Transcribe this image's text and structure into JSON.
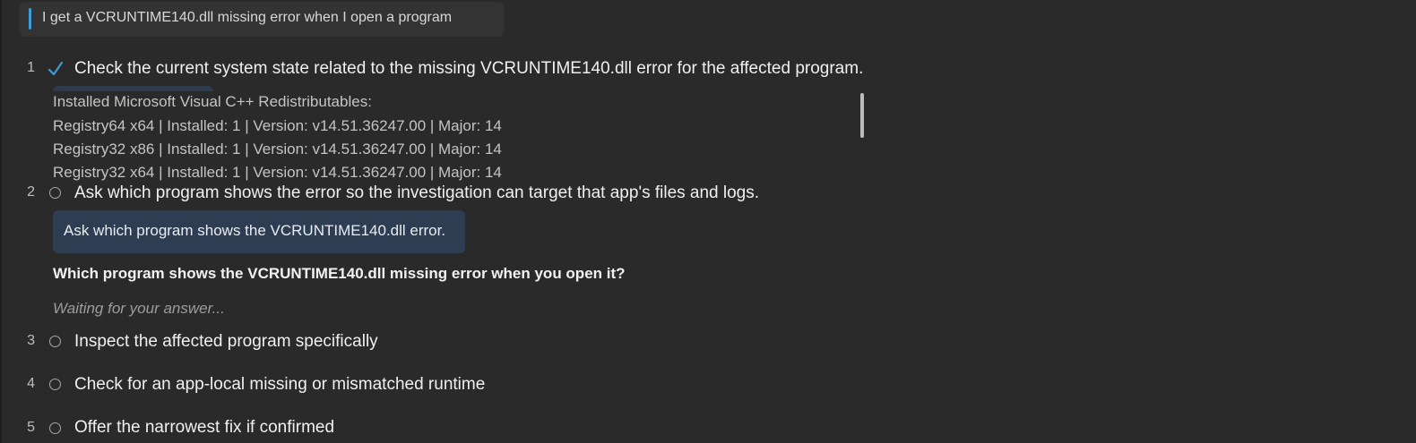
{
  "query": {
    "text": "I get a VCRUNTIME140.dll missing error when I open a program"
  },
  "colors": {
    "background": "#2a2a2a",
    "accent": "#3d9bd6",
    "done_check": "#3d9bd6",
    "action_pill": "#2f3d52"
  },
  "steps": [
    {
      "number": "1",
      "status": "done",
      "status_icon": "check-icon",
      "title": "Check the current system state related to the missing VCRUNTIME140.dll error for the affected program.",
      "output": {
        "lines": [
          "Installed Microsoft Visual C++ Redistributables:",
          "Registry64 x64 | Installed: 1 | Version: v14.51.36247.00 | Major: 14",
          "Registry32 x86 | Installed: 1 | Version: v14.51.36247.00 | Major: 14",
          "Registry32 x64 | Installed: 1 | Version: v14.51.36247.00 | Major: 14"
        ]
      }
    },
    {
      "number": "2",
      "status": "pending",
      "status_icon": "circle-icon",
      "title": "Ask which program shows the error so the investigation can target that app's files and logs.",
      "action_label": "Ask which program shows the VCRUNTIME140.dll error.",
      "question": "Which program shows the VCRUNTIME140.dll missing error when you open it?",
      "waiting": "Waiting for your answer..."
    },
    {
      "number": "3",
      "status": "pending",
      "status_icon": "circle-icon",
      "title": "Inspect the affected program specifically"
    },
    {
      "number": "4",
      "status": "pending",
      "status_icon": "circle-icon",
      "title": "Check for an app-local missing or mismatched runtime"
    },
    {
      "number": "5",
      "status": "pending",
      "status_icon": "circle-icon",
      "title": "Offer the narrowest fix if confirmed"
    }
  ]
}
